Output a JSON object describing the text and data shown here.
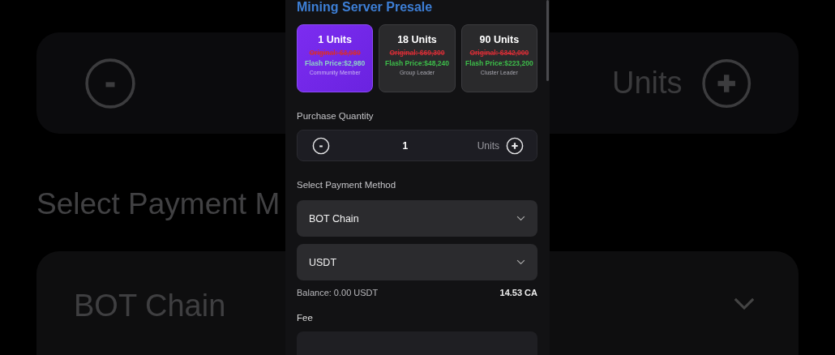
{
  "backdrop": {
    "quantity_unit": "Units",
    "section_label": "Select Payment M",
    "network_value": "BOT Chain"
  },
  "panel": {
    "title": "Mining Server Presale",
    "packages": [
      {
        "units": "1 Units",
        "original": "Original: $3,980",
        "flash_price": "Flash Price:$2,980",
        "tier": "Community Member",
        "selected": true
      },
      {
        "units": "18 Units",
        "original": "Original: $69,300",
        "flash_price": "Flash Price:$48,240",
        "tier": "Group Leader",
        "selected": false
      },
      {
        "units": "90 Units",
        "original": "Original: $342,000",
        "flash_price": "Flash Price:$223,200",
        "tier": "Cluster Leader",
        "selected": false
      }
    ],
    "quantity": {
      "label": "Purchase Quantity",
      "value": "1",
      "unit": "Units"
    },
    "payment": {
      "label": "Select Payment Method",
      "network": "BOT Chain",
      "token": "USDT"
    },
    "balance": {
      "text": "Balance: 0.00 USDT",
      "amount": "14.53 CA"
    },
    "fee": {
      "label": "Fee"
    }
  }
}
